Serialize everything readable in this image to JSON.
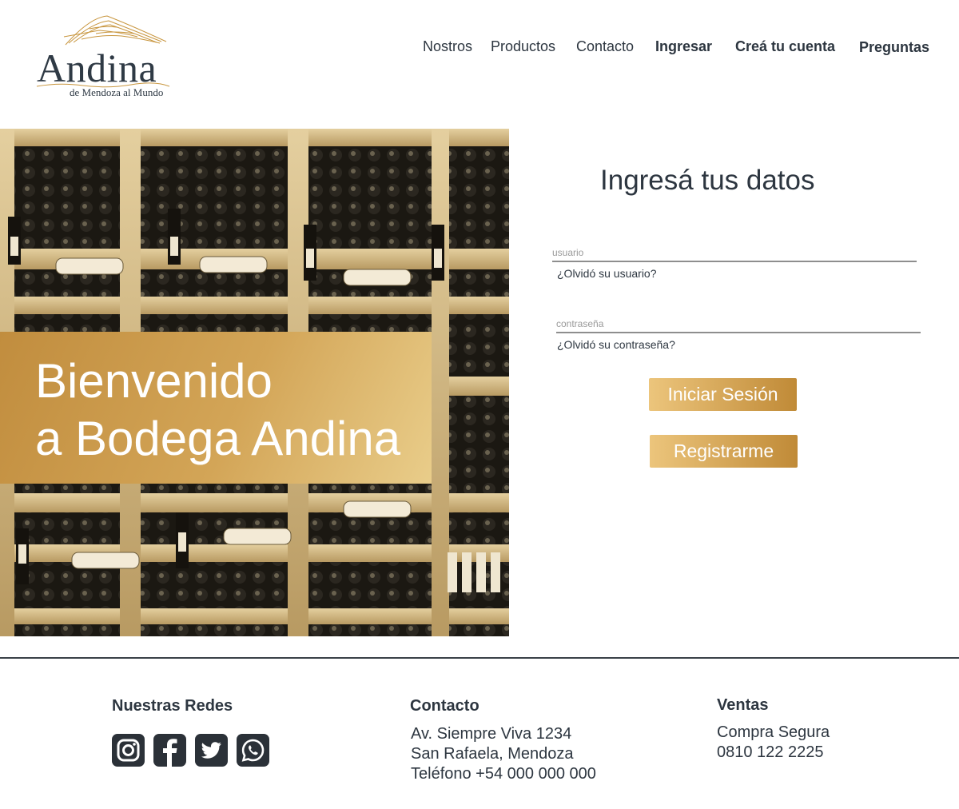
{
  "brand": {
    "name": "Andina",
    "tagline": "de Mendoza al Mundo"
  },
  "nav": {
    "items": [
      "Nostros",
      "Productos",
      "Contacto",
      "Ingresar",
      "Creá tu cuenta",
      "Preguntas"
    ]
  },
  "hero": {
    "title_line1": "Bienvenido",
    "title_line2": "a Bodega Andina"
  },
  "login": {
    "title": "Ingresá tus datos",
    "username_placeholder": "usuario",
    "username_value": "",
    "forgot_username": "¿Olvidó su usuario?",
    "password_placeholder": "contraseña",
    "password_value": "",
    "forgot_password": "¿Olvidó su contraseña?",
    "login_button": "Iniciar Sesión",
    "register_button": "Registrarme"
  },
  "footer": {
    "social": {
      "title": "Nuestras Redes",
      "icons": [
        "instagram-icon",
        "facebook-icon",
        "twitter-icon",
        "whatsapp-icon"
      ]
    },
    "contact": {
      "title": "Contacto",
      "lines": [
        "Av. Siempre Viva 1234",
        "San Rafaela, Mendoza",
        "Teléfono +54 000 000 000"
      ]
    },
    "sales": {
      "title": "Ventas",
      "lines": [
        "Compra Segura",
        "0810 122 2225"
      ]
    }
  },
  "colors": {
    "gold": "#c8963f",
    "gold_light": "#ecc57c",
    "text_dark": "#2d3640"
  }
}
